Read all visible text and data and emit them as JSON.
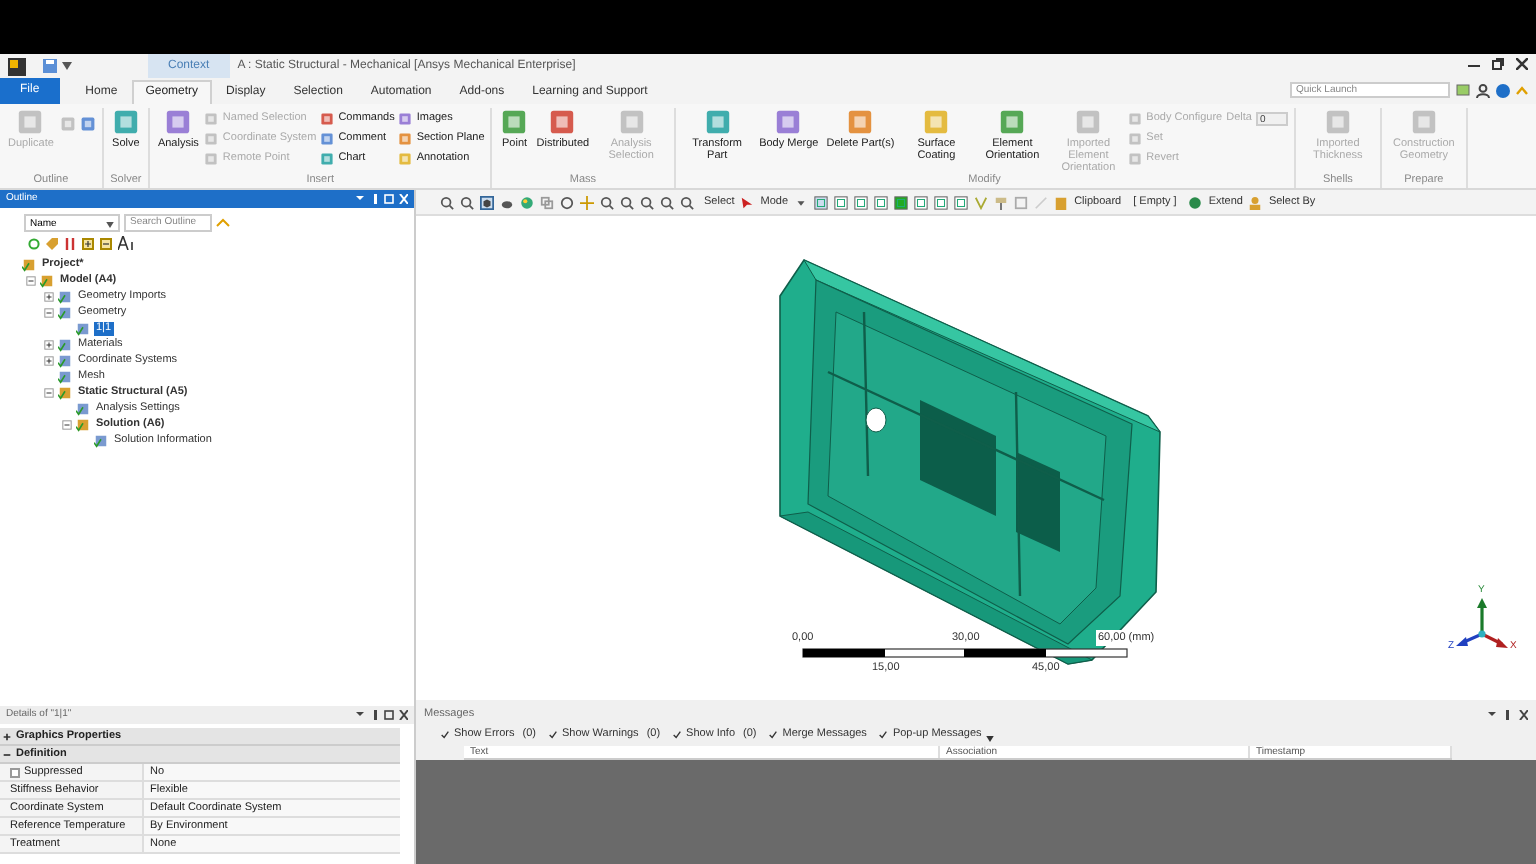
{
  "window": {
    "context_tab": "Context",
    "title": "A : Static Structural - Mechanical [Ansys Mechanical Enterprise]"
  },
  "ribbon_tabs": [
    {
      "label": "File",
      "kind": "file",
      "selected": false
    },
    {
      "label": "Home",
      "kind": "tab",
      "selected": false
    },
    {
      "label": "Geometry",
      "kind": "tab",
      "selected": true
    },
    {
      "label": "Display",
      "kind": "tab",
      "selected": false
    },
    {
      "label": "Selection",
      "kind": "tab",
      "selected": false
    },
    {
      "label": "Automation",
      "kind": "tab",
      "selected": false
    },
    {
      "label": "Add-ons",
      "kind": "tab",
      "selected": false
    },
    {
      "label": "Learning and Support",
      "kind": "tab",
      "selected": false
    }
  ],
  "quick_launch": {
    "placeholder": "Quick Launch"
  },
  "ribbon_groups": [
    {
      "title": "Outline",
      "items": [
        {
          "kind": "large",
          "label": "Duplicate",
          "disabled": true
        },
        {
          "kind": "icon",
          "disabled": true
        },
        {
          "kind": "icon",
          "disabled": false
        }
      ]
    },
    {
      "title": "Solver",
      "items": [
        {
          "kind": "large",
          "label": "Solve",
          "disabled": false
        }
      ]
    },
    {
      "title": "Insert",
      "items": [
        {
          "kind": "large",
          "label": "Analysis",
          "disabled": false
        },
        {
          "kind": "small",
          "label": "Named Selection",
          "disabled": true
        },
        {
          "kind": "small",
          "label": "Coordinate System",
          "disabled": true
        },
        {
          "kind": "small",
          "label": "Remote Point",
          "disabled": true
        },
        {
          "kind": "small",
          "label": "Commands",
          "disabled": false
        },
        {
          "kind": "small",
          "label": "Comment",
          "disabled": false
        },
        {
          "kind": "small",
          "label": "Chart",
          "disabled": false
        },
        {
          "kind": "small",
          "label": "Images",
          "disabled": false
        },
        {
          "kind": "small",
          "label": "Section Plane",
          "disabled": false
        },
        {
          "kind": "small",
          "label": "Annotation",
          "disabled": false
        }
      ]
    },
    {
      "title": "Mass",
      "items": [
        {
          "kind": "large",
          "label": "Point",
          "disabled": false
        },
        {
          "kind": "large",
          "label": "Distributed",
          "disabled": false
        },
        {
          "kind": "large",
          "label": "Analysis Selection",
          "disabled": true
        }
      ]
    },
    {
      "title": "Modify",
      "items": [
        {
          "kind": "large",
          "label": "Transform Part",
          "disabled": false
        },
        {
          "kind": "large",
          "label": "Body Merge",
          "disabled": false
        },
        {
          "kind": "large",
          "label": "Delete Part(s)",
          "disabled": false
        },
        {
          "kind": "large",
          "label": "Surface Coating",
          "disabled": false
        },
        {
          "kind": "large",
          "label": "Element Orientation",
          "disabled": false
        },
        {
          "kind": "large",
          "label": "Imported Element Orientation",
          "disabled": true
        },
        {
          "kind": "small",
          "label": "Body Configure",
          "disabled": true
        },
        {
          "kind": "small",
          "label": "Set",
          "disabled": true
        },
        {
          "kind": "small",
          "label": "Revert",
          "disabled": true
        },
        {
          "kind": "field",
          "label": "Delta",
          "value": "0",
          "disabled": true
        }
      ]
    },
    {
      "title": "Shells",
      "items": [
        {
          "kind": "large",
          "label": "Imported Thickness",
          "disabled": true
        }
      ]
    },
    {
      "title": "Prepare",
      "items": [
        {
          "kind": "large",
          "label": "Construction Geometry",
          "disabled": true
        }
      ]
    }
  ],
  "outline": {
    "title": "Outline",
    "filter": "Name",
    "search": {
      "placeholder": "Search Outline"
    },
    "tree": [
      {
        "label": "Project*",
        "bold": true,
        "selected": false,
        "children": [
          {
            "label": "Model (A4)",
            "bold": true,
            "selected": false,
            "expanded": true,
            "children": [
              {
                "label": "Geometry Imports",
                "bold": false,
                "selected": false,
                "expanded": false
              },
              {
                "label": "Geometry",
                "bold": false,
                "selected": false,
                "expanded": true,
                "children": [
                  {
                    "label": "1|1",
                    "bold": false,
                    "selected": true
                  }
                ]
              },
              {
                "label": "Materials",
                "bold": false,
                "selected": false,
                "expanded": false
              },
              {
                "label": "Coordinate Systems",
                "bold": false,
                "selected": false,
                "expanded": false
              },
              {
                "label": "Mesh",
                "bold": false,
                "selected": false
              },
              {
                "label": "Static Structural (A5)",
                "bold": true,
                "selected": false,
                "expanded": true,
                "children": [
                  {
                    "label": "Analysis Settings",
                    "bold": false,
                    "selected": false
                  },
                  {
                    "label": "Solution (A6)",
                    "bold": true,
                    "selected": false,
                    "expanded": true,
                    "children": [
                      {
                        "label": "Solution Information",
                        "bold": false,
                        "selected": false
                      }
                    ]
                  }
                ]
              }
            ]
          }
        ]
      }
    ]
  },
  "graphics_toolbar": {
    "select": "Select",
    "mode": "Mode",
    "clipboard": "Clipboard",
    "clipboard_value": "[ Empty ]",
    "extend": "Extend",
    "select_by": "Select By"
  },
  "scale_bar": {
    "top_labels": [
      "0,00",
      "30,00",
      "60,00 (mm)"
    ],
    "bottom_labels": [
      "15,00",
      "45,00"
    ]
  },
  "triad": {
    "y": "Y",
    "z": "Z",
    "x": "X"
  },
  "details": {
    "title": "Details of \"1|1\"",
    "sections": [
      {
        "title": "Graphics Properties",
        "expanded": false
      },
      {
        "title": "Definition",
        "expanded": true,
        "rows": [
          {
            "name": "Suppressed",
            "value": "No",
            "kind": "checkbox",
            "checked": false
          },
          {
            "name": "Stiffness Behavior",
            "value": "Flexible",
            "kind": "plain"
          },
          {
            "name": "Coordinate System",
            "value": "Default Coordinate System",
            "kind": "plain"
          },
          {
            "name": "Reference Temperature",
            "value": "By Environment",
            "kind": "plain"
          },
          {
            "name": "Treatment",
            "value": "None",
            "kind": "plain"
          }
        ]
      }
    ]
  },
  "messages": {
    "title": "Messages",
    "filters": [
      {
        "label": "Show Errors",
        "count": "(0)",
        "checked": true
      },
      {
        "label": "Show Warnings",
        "count": "(0)",
        "checked": true
      },
      {
        "label": "Show Info",
        "count": "(0)",
        "checked": true
      },
      {
        "label": "Merge Messages",
        "checked": true
      },
      {
        "label": "Pop-up Messages",
        "checked": true
      }
    ],
    "columns": [
      "Text",
      "Association",
      "Timestamp"
    ]
  }
}
